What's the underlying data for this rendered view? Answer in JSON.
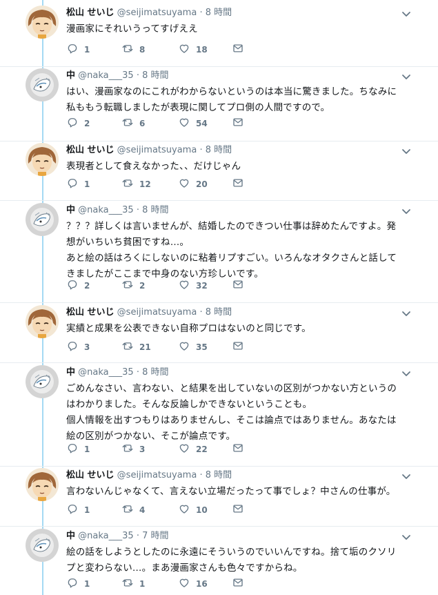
{
  "colors": {
    "accent": "#1da1f2",
    "thread_line": "#a4d9f3",
    "muted": "#657786",
    "text": "#14171a"
  },
  "tweets": [
    {
      "name": "松山 せいじ",
      "handle": "@seijimatsuyama",
      "sep": "·",
      "time": "8 時間",
      "author": "seiji",
      "text": "漫画家にそれいうってすげええ",
      "replies": "1",
      "retweets": "8",
      "likes": "18"
    },
    {
      "name": "中",
      "handle": "@naka___35",
      "sep": "·",
      "time": "8 時間",
      "author": "naka",
      "text": "はい、漫画家なのにこれがわからないというのは本当に驚きました。ちなみに\n私ももう転職しましたが表現に関してプロ側の人間ですので。",
      "replies": "2",
      "retweets": "6",
      "likes": "54"
    },
    {
      "name": "松山 せいじ",
      "handle": "@seijimatsuyama",
      "sep": "·",
      "time": "8 時間",
      "author": "seiji",
      "text": "表現者として食えなかった、、だけじゃん",
      "replies": "1",
      "retweets": "12",
      "likes": "20"
    },
    {
      "name": "中",
      "handle": "@naka___35",
      "sep": "·",
      "time": "8 時間",
      "author": "naka",
      "text": "？？？詳しくは言いませんが、結婚したのできつい仕事は辞めたんですよ。発\n想がいちいち貧困ですね…。\nあと絵の話はろくにしないのに粘着リプすごい。いろんなオタクさんと話して\nきましたがここまで中身のない方珍しいです。",
      "replies": "2",
      "retweets": "2",
      "likes": "32"
    },
    {
      "name": "松山 せいじ",
      "handle": "@seijimatsuyama",
      "sep": "·",
      "time": "8 時間",
      "author": "seiji",
      "text": "実績と成果を公表できない自称プロはないのと同じです。",
      "replies": "3",
      "retweets": "21",
      "likes": "35"
    },
    {
      "name": "中",
      "handle": "@naka___35",
      "sep": "·",
      "time": "8 時間",
      "author": "naka",
      "text": "ごめんなさい、言わない、と結果を出していないの区別がつかない方というの\nはわかりました。そんな反論しかできないということも。\n個人情報を出すつもりはありませんし、そこは論点ではありません。あなたは\n絵の区別がつかない、そこが論点です。",
      "replies": "1",
      "retweets": "3",
      "likes": "22"
    },
    {
      "name": "松山 せいじ",
      "handle": "@seijimatsuyama",
      "sep": "·",
      "time": "8 時間",
      "author": "seiji",
      "text": "言わないんじゃなくて、言えない立場だったって事でしょ？中さんの仕事が。",
      "replies": "1",
      "retweets": "4",
      "likes": "10"
    },
    {
      "name": "中",
      "handle": "@naka___35",
      "sep": "·",
      "time": "7 時間",
      "author": "naka",
      "text": "絵の話をしようとしたのに永遠にそういうのでいいんですね。捨て垢のクソリ\nプと変わらない…。まあ漫画家さんも色々ですからね。",
      "replies": "1",
      "retweets": "1",
      "likes": "16"
    }
  ]
}
